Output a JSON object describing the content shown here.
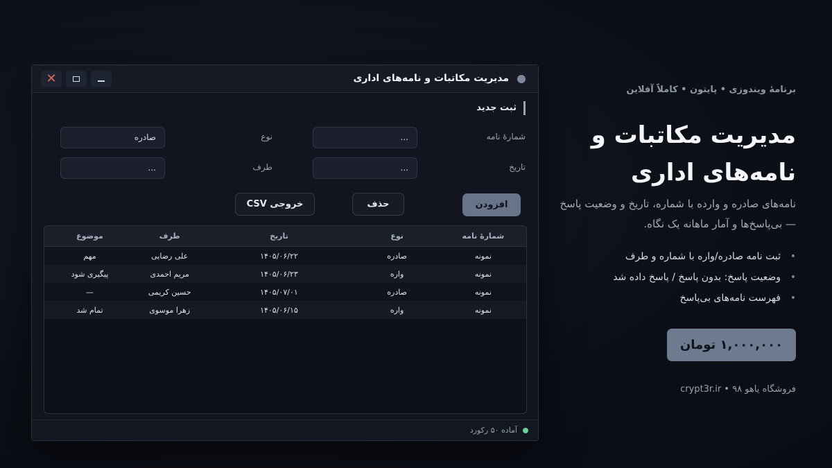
{
  "window": {
    "title": "مدیریت مکاتبات و نامه‌های اداری",
    "controls": {
      "close_icon": "close-icon",
      "maximize_icon": "maximize-icon",
      "minimize_icon": "minimize-icon"
    }
  },
  "form": {
    "section_title": "ثبت جدید",
    "fields": {
      "letter_number": {
        "label": "شمارهٔ نامه",
        "value": "..."
      },
      "type": {
        "label": "نوع",
        "value": "صادره"
      },
      "date": {
        "label": "تاریخ",
        "value": "..."
      },
      "party": {
        "label": "طرف",
        "value": "..."
      }
    },
    "buttons": {
      "add": "افزودن",
      "delete": "حذف",
      "export": "خروجی CSV"
    }
  },
  "table": {
    "columns": [
      "شمارهٔ نامه",
      "نوع",
      "تاریخ",
      "طرف",
      "موضوع"
    ],
    "rows": [
      [
        "نمونه",
        "صادره",
        "۱۴۰۵/۰۶/۲۲",
        "علی رضایی",
        "مهم"
      ],
      [
        "نمونه",
        "واره",
        "۱۴۰۵/۰۶/۲۳",
        "مریم احمدی",
        "پیگیری شود"
      ],
      [
        "نمونه",
        "صادره",
        "۱۴۰۵/۰۷/۰۱",
        "حسین کریمی",
        "—"
      ],
      [
        "نمونه",
        "واره",
        "۱۴۰۵/۰۶/۱۵",
        "زهرا موسوی",
        "تمام شد"
      ]
    ]
  },
  "status": {
    "text": "آماده ۵۰ رکورد",
    "color": "#6fd19a"
  },
  "promo": {
    "tagline": "برنامهٔ ویندوزی • پایتون • کاملاً آفلاین",
    "headline_line1": "مدیریت مکاتبات و",
    "headline_line2": "نامه‌های اداری",
    "description": "نامه‌های صادره و وارده با شماره، تاریخ و وضعیت پاسخ — بی‌پاسخ‌ها و آمار ماهانه یک نگاه.",
    "features": [
      "ثبت نامه صادره/واره با شماره و طرف",
      "وضعیت پاسخ: بدون پاسخ / پاسخ داده شد",
      "فهرست نامه‌های بی‌پاسخ"
    ],
    "price": "۱,۰۰۰,۰۰۰ تومان",
    "store": "crypt3r.ir • ۹۸ فروشگاه یاهو"
  },
  "colors": {
    "accent": "#6e7a8f",
    "close": "#e06b55",
    "background": "#0c0f17"
  }
}
